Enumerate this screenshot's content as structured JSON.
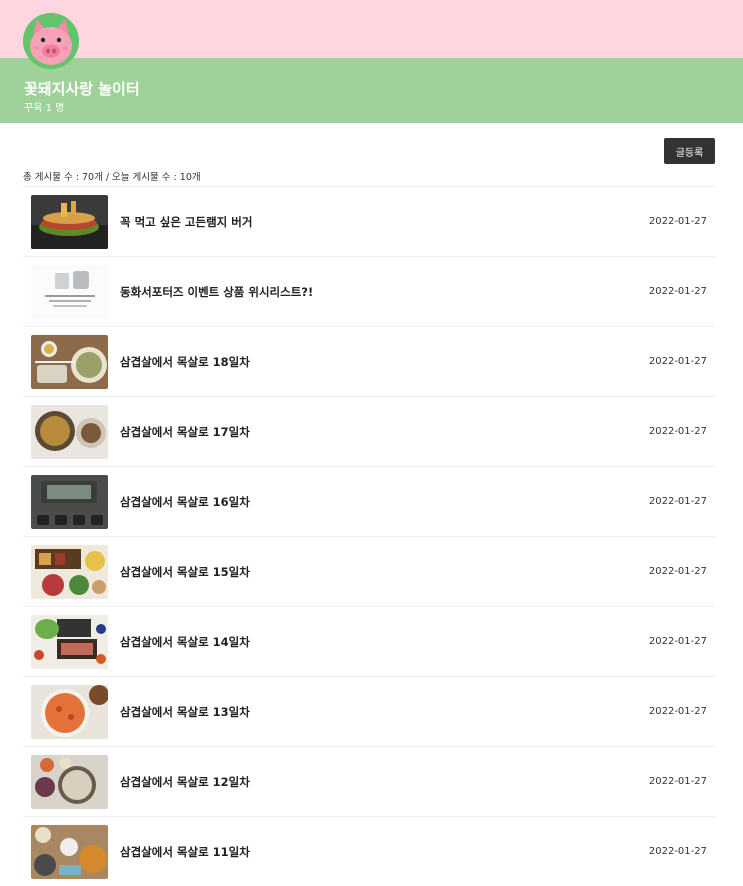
{
  "header": {
    "cafe_name": "꽃돼지사랑 놀이터",
    "member_label": "꾸욱 1 명",
    "avatar_icon": "pig-face-icon",
    "top_color": "#fdd6df",
    "band_color": "#9ed29a"
  },
  "toolbar": {
    "write_label": "글등록"
  },
  "stats": {
    "text": "총 게시물 수 : 70개 / 오늘 게시물 수 : 10개"
  },
  "posts": [
    {
      "title": "꼭 먹고 싶은 고든램지 버거",
      "date": "2022-01-27"
    },
    {
      "title": "동화서포터즈 이벤트 상품 위시리스트?!",
      "date": "2022-01-27"
    },
    {
      "title": "삼겹살에서 목살로 18일차",
      "date": "2022-01-27"
    },
    {
      "title": "삼겹살에서 목살로 17일차",
      "date": "2022-01-27"
    },
    {
      "title": "삼겹살에서 목살로 16일차",
      "date": "2022-01-27"
    },
    {
      "title": "삼겹살에서 목살로 15일차",
      "date": "2022-01-27"
    },
    {
      "title": "삼겹살에서 목살로 14일차",
      "date": "2022-01-27"
    },
    {
      "title": "삼겹살에서 목살로 13일차",
      "date": "2022-01-27"
    },
    {
      "title": "삼겹살에서 목살로 12일차",
      "date": "2022-01-27"
    },
    {
      "title": "삼겹살에서 목살로 11일차",
      "date": "2022-01-27"
    }
  ]
}
